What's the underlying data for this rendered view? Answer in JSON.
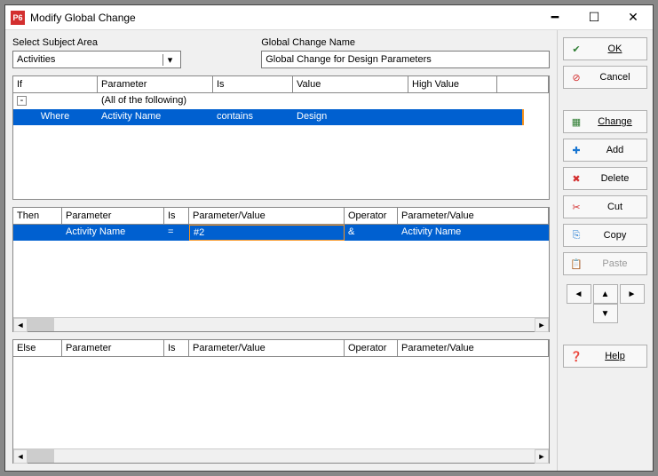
{
  "window": {
    "app_icon_text": "P6",
    "title": "Modify Global Change"
  },
  "fields": {
    "subject_area_label": "Select Subject Area",
    "subject_area_value": "Activities",
    "global_change_name_label": "Global Change Name",
    "global_change_name_value": "Global Change for Design Parameters"
  },
  "if_grid": {
    "cols": [
      "If",
      "Parameter",
      "Is",
      "Value",
      "High Value"
    ],
    "rows": [
      {
        "indent": true,
        "expand": "-",
        "parameter": "(All of the following)",
        "is": "",
        "value": "",
        "high": ""
      },
      {
        "if": "Where",
        "parameter": "Activity Name",
        "is": "contains",
        "value": "Design",
        "high": "",
        "selected": true
      }
    ]
  },
  "then_grid": {
    "cols": [
      "Then",
      "Parameter",
      "Is",
      "Parameter/Value",
      "Operator",
      "Parameter/Value"
    ],
    "rows": [
      {
        "then": "",
        "parameter": "Activity Name",
        "is": "=",
        "pv1": "#2",
        "op": "&",
        "pv2": "Activity Name",
        "selected": true,
        "editing": true
      }
    ]
  },
  "else_grid": {
    "cols": [
      "Else",
      "Parameter",
      "Is",
      "Parameter/Value",
      "Operator",
      "Parameter/Value"
    ]
  },
  "buttons": {
    "ok": "OK",
    "cancel": "Cancel",
    "change": "Change",
    "add": "Add",
    "delete": "Delete",
    "cut": "Cut",
    "copy": "Copy",
    "paste": "Paste",
    "help": "Help"
  }
}
